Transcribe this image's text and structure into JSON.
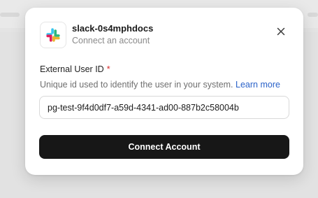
{
  "app": {
    "name": "slack-0s4mphdocs",
    "subtitle": "Connect an account",
    "logo_icon": "slack-logo",
    "logo_colors": [
      "#36C5F0",
      "#2EB67D",
      "#ECB22E",
      "#E01E5A"
    ]
  },
  "form": {
    "field_label": "External User ID",
    "required_marker": "*",
    "help_text": "Unique id used to identify the user in your system.",
    "help_link": "Learn more",
    "input_value": "pg-test-9f4d0df7-a59d-4341-ad00-887b2c58004b"
  },
  "actions": {
    "connect_label": "Connect Account",
    "close_icon": "close-icon"
  },
  "colors": {
    "primary_button": "#171717",
    "link": "#2a62c9",
    "required": "#d62b2b"
  }
}
